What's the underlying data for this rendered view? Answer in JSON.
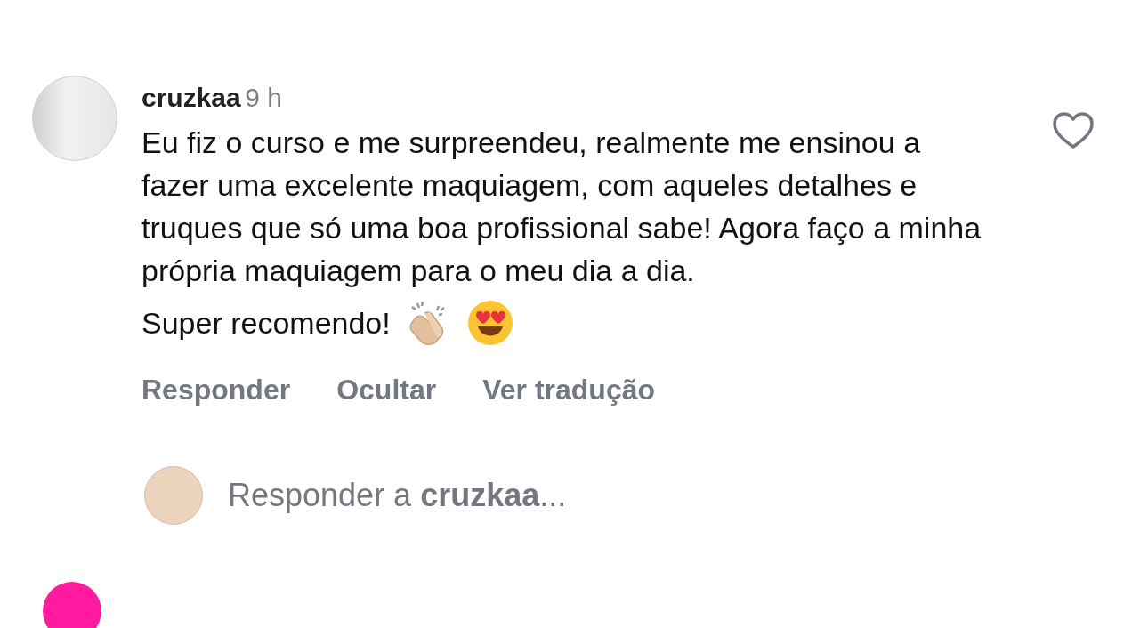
{
  "comment": {
    "username": "cruzkaa",
    "time": "9 h",
    "liked": false,
    "text": "Eu fiz o curso e me surpreendeu, realmente me ensinou a fazer uma excelente maquiagem, com aqueles detalhes e truques que só uma boa profissional sabe! Agora faço a minha própria maquiagem para o meu dia a dia.",
    "closing": "Super recomendo!",
    "actions": [
      "Responder",
      "Ocultar",
      "Ver tradução"
    ]
  },
  "reply_field": {
    "placeholder": "Responder a **cruzkaa**..."
  }
}
